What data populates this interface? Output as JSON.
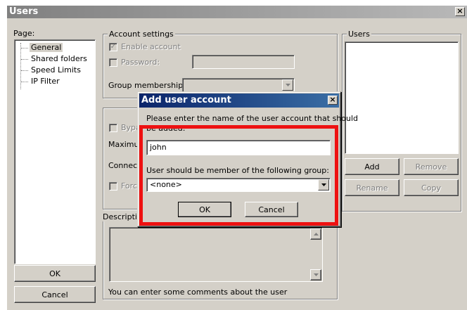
{
  "window": {
    "title": "Users",
    "close_glyph": "×"
  },
  "page_panel": {
    "label": "Page:",
    "items": [
      "General",
      "Shared folders",
      "Speed Limits",
      "IP Filter"
    ],
    "selected": "General"
  },
  "account_settings": {
    "legend": "Account settings",
    "enable_account": "Enable account",
    "password": "Password:",
    "group_membership": "Group membership:"
  },
  "bypass_group": {
    "bypass_prefix": "Bypa",
    "maximum_prefix": "Maximun",
    "connect_prefix": "Connect",
    "force_prefix": "Force"
  },
  "description": {
    "legend": "Descripti",
    "hint": "You can enter some comments about the user"
  },
  "users_panel": {
    "legend": "Users",
    "add": "Add",
    "remove": "Remove",
    "rename": "Rename",
    "copy": "Copy"
  },
  "buttons": {
    "ok": "OK",
    "cancel": "Cancel"
  },
  "dialog": {
    "title": "Add user account",
    "close_glyph": "×",
    "prompt_line1": "Please enter the name of the user account that should",
    "prompt_line2": "be added:",
    "name_value": "john",
    "group_label": "User should be member of the following group:",
    "group_value": "<none>",
    "ok": "OK",
    "cancel": "Cancel"
  },
  "colors": {
    "highlight": "#ee1111",
    "dialog_title": "#0a246a"
  }
}
